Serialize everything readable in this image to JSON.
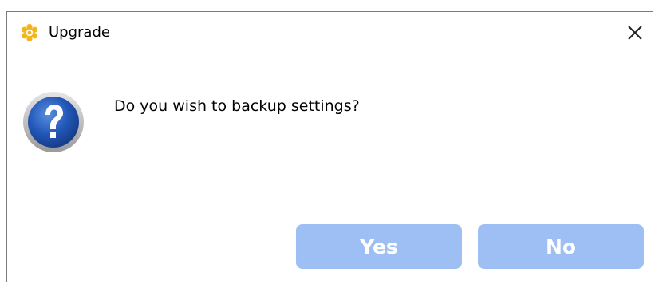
{
  "window": {
    "title": "Upgrade",
    "app_icon": "gear-flower-icon",
    "close_icon": "close-icon"
  },
  "content": {
    "icon": "question-icon",
    "message": "Do you wish to backup settings?"
  },
  "buttons": {
    "yes_label": "Yes",
    "no_label": "No"
  },
  "colors": {
    "button_bg": "#9dbff3",
    "button_text": "#ffffff",
    "app_icon": "#f2b61c",
    "question_blue": "#2257b8"
  }
}
